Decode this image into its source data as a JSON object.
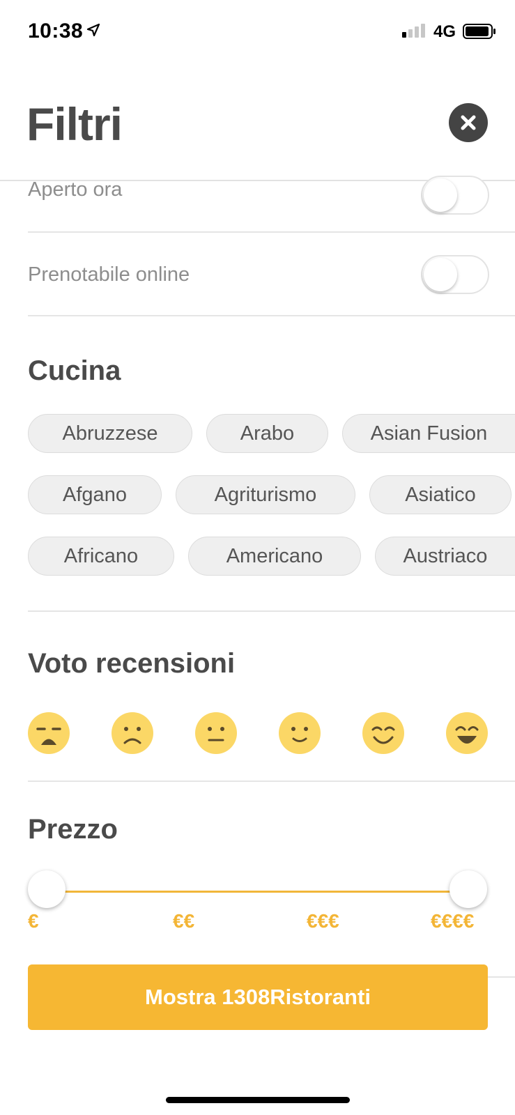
{
  "status_bar": {
    "time": "10:38",
    "network": "4G",
    "icons": [
      "location-arrow-icon",
      "signal-icon",
      "battery-icon"
    ]
  },
  "header": {
    "title": "Filtri",
    "close_icon": "close-icon"
  },
  "toggles": [
    {
      "label": "Aperto ora",
      "on": false
    },
    {
      "label": "Prenotabile online",
      "on": false
    }
  ],
  "cuisine": {
    "title": "Cucina",
    "chips": [
      "Abruzzese",
      "Arabo",
      "Asian Fusion",
      "Afgano",
      "Agriturismo",
      "Asiatico",
      "Africano",
      "Americano",
      "Austriaco"
    ]
  },
  "rating": {
    "title": "Voto recensioni",
    "faces": [
      "very-sad-face-icon",
      "sad-face-icon",
      "neutral-face-icon",
      "slight-smile-face-icon",
      "smile-face-icon",
      "grin-face-icon"
    ]
  },
  "price": {
    "title": "Prezzo",
    "labels": [
      "€",
      "€€",
      "€€€",
      "€€€€"
    ],
    "range_min_level": 1,
    "range_max_level": 4
  },
  "cta": {
    "label": "Mostra 1308Ristoranti"
  },
  "colors": {
    "accent": "#f6b733",
    "face": "#fbd766",
    "text_dark": "#4a4a4a",
    "text_muted": "#8d8d8d"
  }
}
